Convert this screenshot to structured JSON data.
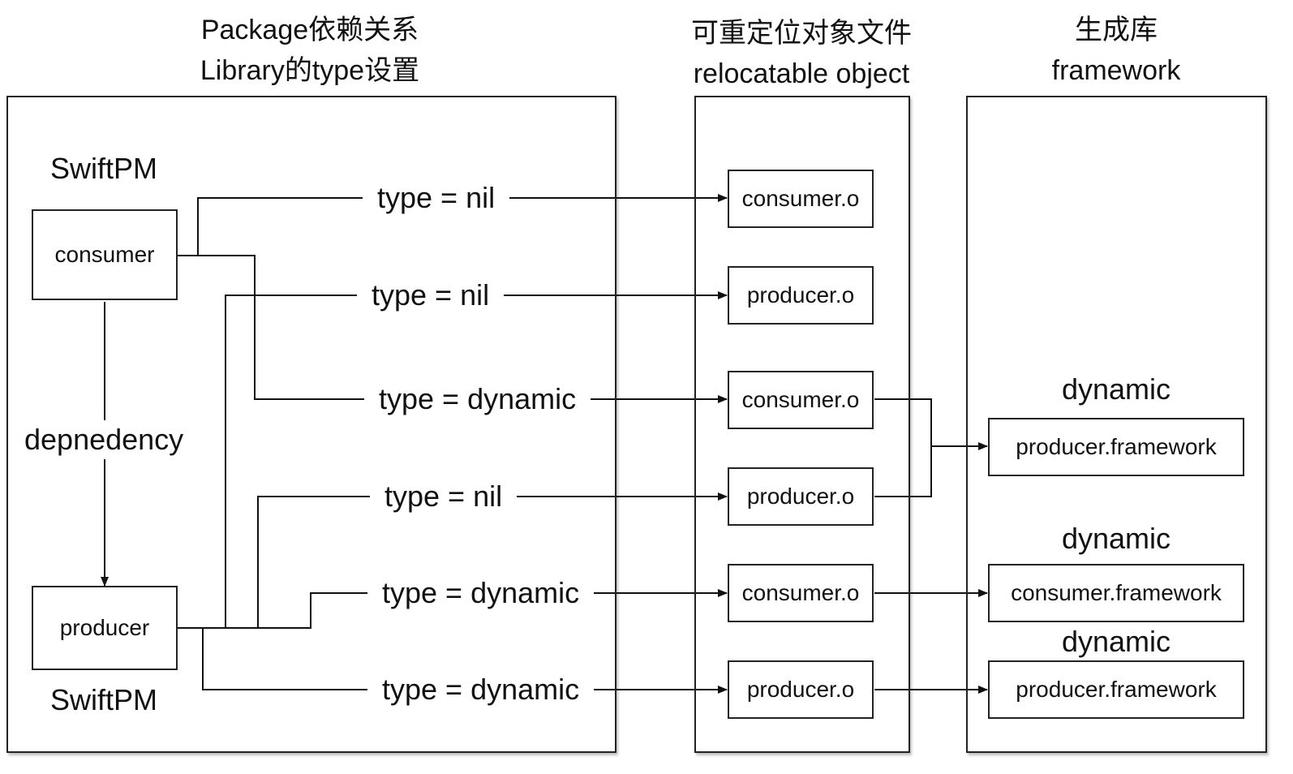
{
  "headers": {
    "package": {
      "line1": "Package依赖关系",
      "line2": "Library的type设置"
    },
    "object": {
      "line1": "可重定位对象文件",
      "line2": "relocatable object"
    },
    "library": {
      "line1": "生成库",
      "line2": "framework"
    }
  },
  "package_panel": {
    "top_label": "SwiftPM",
    "bottom_label": "SwiftPM",
    "consumer": "consumer",
    "producer": "producer",
    "dependency_label": "depnedency"
  },
  "edges": [
    {
      "label": "type = nil"
    },
    {
      "label": "type = nil"
    },
    {
      "label": "type = dynamic"
    },
    {
      "label": "type = nil"
    },
    {
      "label": "type = dynamic"
    },
    {
      "label": "type = dynamic"
    }
  ],
  "objects": [
    {
      "name": "consumer.o"
    },
    {
      "name": "producer.o"
    },
    {
      "name": "consumer.o"
    },
    {
      "name": "producer.o"
    },
    {
      "name": "consumer.o"
    },
    {
      "name": "producer.o"
    }
  ],
  "frameworks": [
    {
      "kind": "dynamic",
      "name": "producer.framework"
    },
    {
      "kind": "dynamic",
      "name": "consumer.framework"
    },
    {
      "kind": "dynamic",
      "name": "producer.framework"
    }
  ],
  "colors": {
    "line": "#111111",
    "border": "#222222",
    "background": "#ffffff"
  }
}
